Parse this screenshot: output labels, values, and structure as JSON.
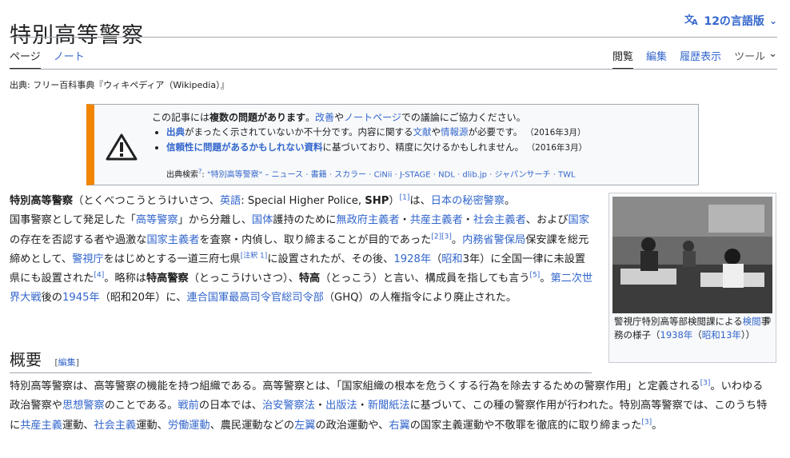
{
  "title": "特別高等警察",
  "lang_button": "12の言語版",
  "tabs_left": [
    "ページ",
    "ノート"
  ],
  "tabs_right": [
    "閲覧",
    "編集",
    "履歴表示"
  ],
  "tools": "ツール",
  "source": "出典: フリー百科事典『ウィキペディア（Wikipedia）』",
  "ambox": {
    "lead_a": "この記事には",
    "lead_b": "複数の問題があります",
    "lead_c": "。",
    "lead_link1": "改善",
    "lead_d": "や",
    "lead_link2": "ノートページ",
    "lead_e": "での議論にご協力ください。",
    "item1_link": "出典",
    "item1_text": "がまったく示されていないか不十分です。内容に関する",
    "item1_link2": "文献",
    "item1_text2": "や",
    "item1_link3": "情報源",
    "item1_text3": "が必要です。",
    "item1_date": "（2016年3月）",
    "item2_link": "信頼性に問題があるかもしれない資料",
    "item2_text": "に基づいており、精度に欠けるかもしれません。",
    "item2_date": "（2016年3月）",
    "search_label": "出典検索",
    "search_q": "\"特別高等警察\"",
    "search_links": "– ニュース · 書籍 · スカラー · CiNii · J-STAGE · NDL · dlib.jp · ジャパンサーチ · TWL"
  },
  "lead": {
    "p1_b": "特別高等警察",
    "p1_a": "（とくべつこうとうけいさつ、",
    "p1_l1": "英語",
    "p1_c": ": Special Higher Police, ",
    "p1_b2": "SHP",
    "p1_d": "）",
    "ref1": "[1]",
    "p1_e": "は、",
    "p1_l2": "日本の秘密警察",
    "p1_f": "。",
    "p2": "国事警察として発足した「",
    "p2_l1": "高等警察",
    "p2_a": "」から分離し、",
    "p2_l2": "国体",
    "p2_b": "護持のために",
    "p2_l3": "無政府主義者",
    "p2_c": "・",
    "p2_l4": "共産主義者",
    "p2_d": "・",
    "p2_l5": "社会主義者",
    "p2_e": "、および",
    "p2_l6": "国家",
    "p2_f": "の存在を否認する者や過激な",
    "p2_l7": "国家主義者",
    "p2_g": "を査察・内偵し、取り締まることが目的であった",
    "ref23": "[2][3]",
    "p2_h": "。",
    "p3_l1": "内務省警保局",
    "p3_a": "保安課を総元締めとして、",
    "p3_l2": "警視庁",
    "p3_b": "をはじめとする一道三府七県",
    "note1": "[注釈 1]",
    "p3_c": "に設置されたが、その後、",
    "p3_l3": "1928年",
    "p3_d": "（",
    "p3_l4": "昭和",
    "p3_e": "3年）に全国一律に未設置県にも設置された",
    "ref4": "[4]",
    "p3_f": "。略称は",
    "p3_b1": "特高警察",
    "p3_g": "（とっこうけいさつ）、",
    "p3_b2": "特高",
    "p3_h": "（とっこう）と言い、構成員を指しても言う",
    "ref5": "[5]",
    "p3_i": "。",
    "p3_l5": "第二次世界大戦",
    "p3_j": "後の",
    "p3_l6": "1945年",
    "p3_k": "（昭和20年）に、",
    "p3_l7": "連合国軍最高司令官総司令部",
    "p3_l": "（GHQ）の人権指令により廃止された。"
  },
  "thumb": {
    "cap_a": "警視庁特別高等部検閲課による",
    "cap_l1": "検閲",
    "cap_b": "事務の様子（",
    "cap_l2": "1938年",
    "cap_c": "（",
    "cap_l3": "昭和13年",
    "cap_d": "））"
  },
  "section": {
    "heading": "概要",
    "edit_open": "[",
    "edit_label": "編集",
    "edit_close": "]",
    "s1": "特別高等警察は、高等警察の機能を持つ組織である。高等警察とは、「国家組織の根本を危うくする行為を除去するための警察作用」と定義される",
    "ref3a": "[3]",
    "s2": "。いわゆる政治警察や",
    "s_l1": "思想警察",
    "s3": "のことである。",
    "s_l2": "戦前",
    "s4": "の日本では、",
    "s_l3": "治安警察法",
    "s5": "・",
    "s_l4": "出版法",
    "s6": "・",
    "s_l5": "新聞紙法",
    "s7": "に基づいて、この種の警察作用が行われた。特別高等警察では、このうち特に",
    "s_l6": "共産主義",
    "s8": "運動、",
    "s_l7": "社会主義",
    "s9": "運動、",
    "s_l8": "労働運動",
    "s10": "、農民運動などの",
    "s_l9": "左翼",
    "s11": "の政治運動や、",
    "s_l10": "右翼",
    "s12": "の国家主義運動や不敬罪を徹底的に取り締まった",
    "ref3b": "[3]",
    "s13": "。"
  }
}
